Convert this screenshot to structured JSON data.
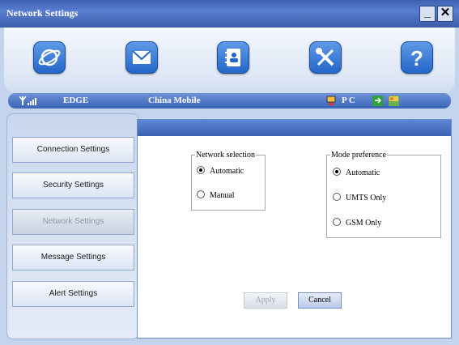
{
  "window": {
    "title": "Network Settings"
  },
  "toolbar": {
    "items": [
      {
        "icon": "globe-icon"
      },
      {
        "icon": "envelope-icon"
      },
      {
        "icon": "contacts-book-icon"
      },
      {
        "icon": "tools-icon"
      },
      {
        "icon": "help-icon"
      }
    ]
  },
  "status": {
    "network_type": "EDGE",
    "operator": "China Mobile",
    "pc_label": "P C"
  },
  "sidebar": {
    "items": [
      {
        "label": "Connection Settings"
      },
      {
        "label": "Security Settings"
      },
      {
        "label": "Network Settings",
        "active": true
      },
      {
        "label": "Message Settings"
      },
      {
        "label": "Alert Settings"
      }
    ]
  },
  "network_selection": {
    "title": "Network selection",
    "options": [
      {
        "label": "Automatic",
        "selected": true
      },
      {
        "label": "Manual",
        "selected": false
      }
    ]
  },
  "mode_preference": {
    "title": "Mode preference",
    "options": [
      {
        "label": "Automatic",
        "selected": true
      },
      {
        "label": "UMTS Only",
        "selected": false
      },
      {
        "label": "GSM Only",
        "selected": false
      }
    ]
  },
  "actions": {
    "apply": "Apply",
    "cancel": "Cancel"
  }
}
